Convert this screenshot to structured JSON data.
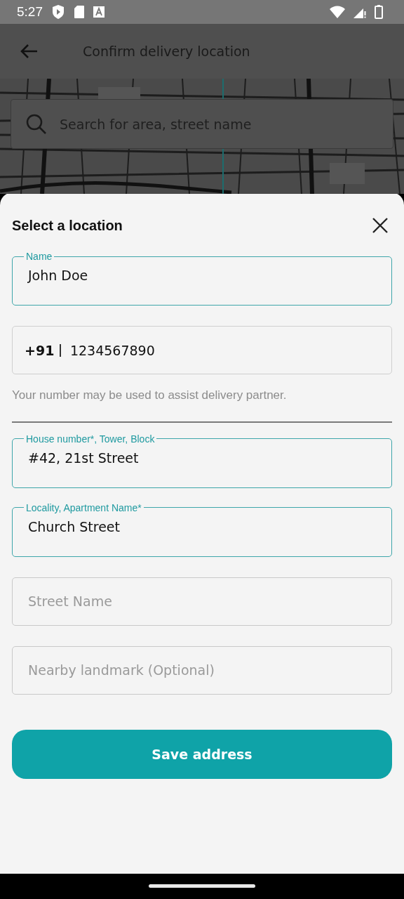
{
  "status_bar": {
    "time": "5:27"
  },
  "toolbar": {
    "title": "Confirm delivery location"
  },
  "map": {
    "search": {
      "placeholder": "Search for area, street name"
    }
  },
  "sheet": {
    "title": "Select a location",
    "fields": [
      {
        "kind": "text",
        "label": "Name",
        "value": "John Doe"
      },
      {
        "kind": "phone",
        "prefix": "+91",
        "value": "1234567890",
        "helper": "Your number may be used to assist delivery partner."
      },
      {
        "kind": "divider"
      },
      {
        "kind": "text",
        "label": "House number*, Tower, Block",
        "value": "#42, 21st Street"
      },
      {
        "kind": "text",
        "label": "Locality, Apartment Name*",
        "value": "Church Street"
      },
      {
        "kind": "text",
        "placeholder": "Street Name"
      },
      {
        "kind": "text",
        "placeholder": "Nearby landmark (Optional)"
      }
    ],
    "button": "Save address"
  }
}
